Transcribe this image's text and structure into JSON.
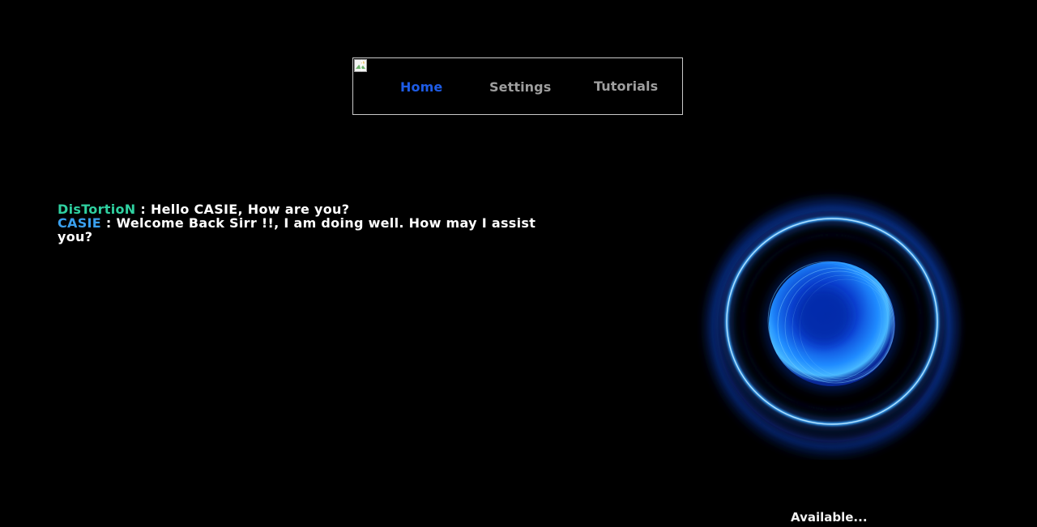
{
  "nav": {
    "links": [
      {
        "label": "Home",
        "active": true
      },
      {
        "label": "Settings",
        "active": false
      },
      {
        "label": "Tutorials",
        "active": false
      }
    ]
  },
  "chat": {
    "messages": [
      {
        "speaker": "DisTortioN",
        "separator": " : ",
        "text": "Hello CASIE, How are you?"
      },
      {
        "speaker": "CASIE",
        "separator": " : ",
        "text": "Welcome Back Sirr !!, I am doing well. How may I assist you?"
      }
    ]
  },
  "status": {
    "text": "Available..."
  },
  "colors": {
    "background": "#000000",
    "nav_active": "#1e5ce6",
    "nav_inactive": "#9e9e9e",
    "user_speaker": "#2fd0a0",
    "bot_speaker": "#3aa0ee",
    "orb_glow": "#2a7bff"
  },
  "icons": {
    "nav_image": "broken-image-icon",
    "assistant_visual": "glowing-orb"
  }
}
